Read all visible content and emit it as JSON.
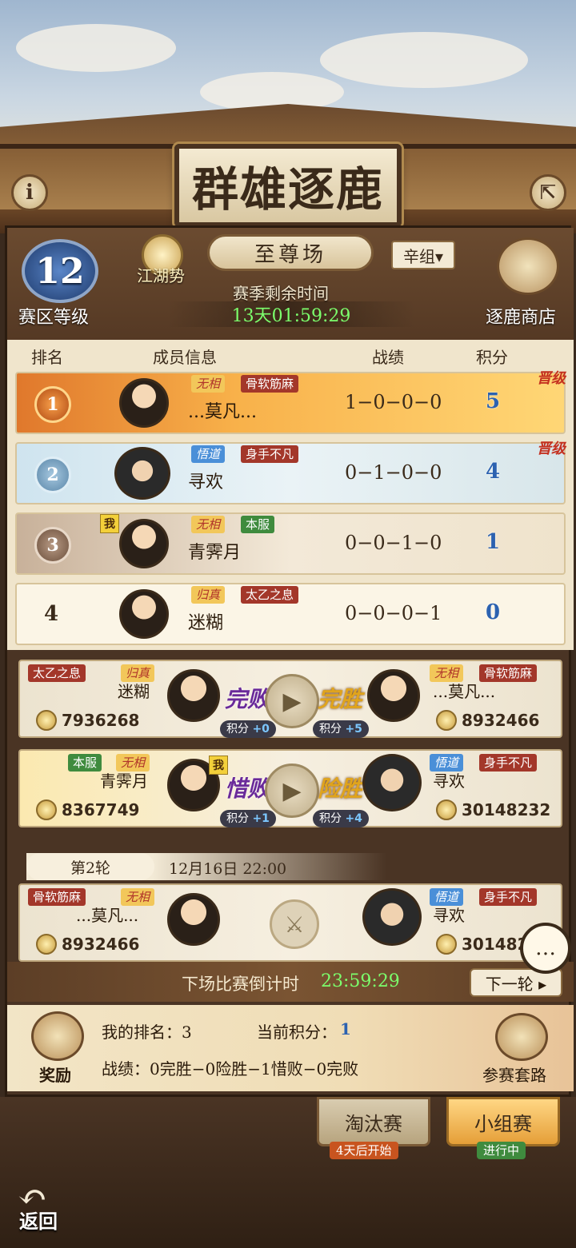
{
  "title": "群雄逐鹿",
  "info_icon": "info-icon",
  "share_icon": "share-icon",
  "header": {
    "region_level_value": "12",
    "region_level_label": "赛区等级",
    "jianghu_label": "江湖势",
    "mode": "至尊场",
    "group": "辛组▾",
    "season_label": "赛季剩余时间",
    "season_time": "13天01:59:29",
    "shop_label": "逐鹿商店"
  },
  "table": {
    "headers": [
      "排名",
      "成员信息",
      "战绩",
      "积分"
    ],
    "rows": [
      {
        "rank": "1",
        "tags": [
          "无相",
          "骨软筋麻"
        ],
        "name": "...莫凡...",
        "record": "1−0−0−0",
        "score": "5",
        "promo": "晋级"
      },
      {
        "rank": "2",
        "tags": [
          "悟道",
          "身手不凡"
        ],
        "name": "寻欢",
        "record": "0−1−0−0",
        "score": "4",
        "promo": "晋级"
      },
      {
        "rank": "3",
        "tags": [
          "无相",
          "本服"
        ],
        "name": "青霁月",
        "record": "0−0−1−0",
        "score": "1",
        "me": "我"
      },
      {
        "rank": "4",
        "tags": [
          "归真",
          "太乙之息"
        ],
        "name": "迷糊",
        "record": "0−0−0−1",
        "score": "0"
      }
    ]
  },
  "matches": [
    {
      "left_tags": [
        "太乙之息",
        "归真"
      ],
      "left_name": "迷糊",
      "left_power": "7936268",
      "left_result": "完败",
      "left_pts": "+0",
      "right_tags": [
        "无相",
        "骨软筋麻"
      ],
      "right_name": "...莫凡...",
      "right_power": "8932466",
      "right_result": "完胜",
      "right_pts": "+5"
    },
    {
      "left_tags": [
        "本服",
        "无相"
      ],
      "left_name": "青霁月",
      "left_power": "8367749",
      "left_result": "惜败",
      "left_pts": "+1",
      "me": "我",
      "right_tags": [
        "悟道",
        "身手不凡"
      ],
      "right_name": "寻欢",
      "right_power": "30148232",
      "right_result": "险胜",
      "right_pts": "+4"
    }
  ],
  "pts_label": "积分",
  "round2": {
    "label": "第2轮",
    "time": "12月16日 22:00",
    "left_tags": [
      "骨软筋麻",
      "无相"
    ],
    "left_name": "...莫凡...",
    "left_power": "8932466",
    "right_tags": [
      "悟道",
      "身手不凡"
    ],
    "right_name": "寻欢",
    "right_power": "3014823"
  },
  "countdown": {
    "label": "下场比赛倒计时",
    "time": "23:59:29",
    "next": "下一轮 ▸"
  },
  "mine": {
    "reward_label": "奖励",
    "rank_text": "我的排名：3",
    "score_label": "当前积分：",
    "score_value": "1",
    "record_text": "战绩：0完胜−0险胜−1惜败−0完败",
    "tactics_label": "参赛套路"
  },
  "tabs": [
    {
      "label": "淘汰赛",
      "status": "4天后开始",
      "status_color": "#c8541f"
    },
    {
      "label": "小组赛",
      "status": "进行中",
      "status_color": "#3f8b3e"
    }
  ],
  "back_label": "返回"
}
